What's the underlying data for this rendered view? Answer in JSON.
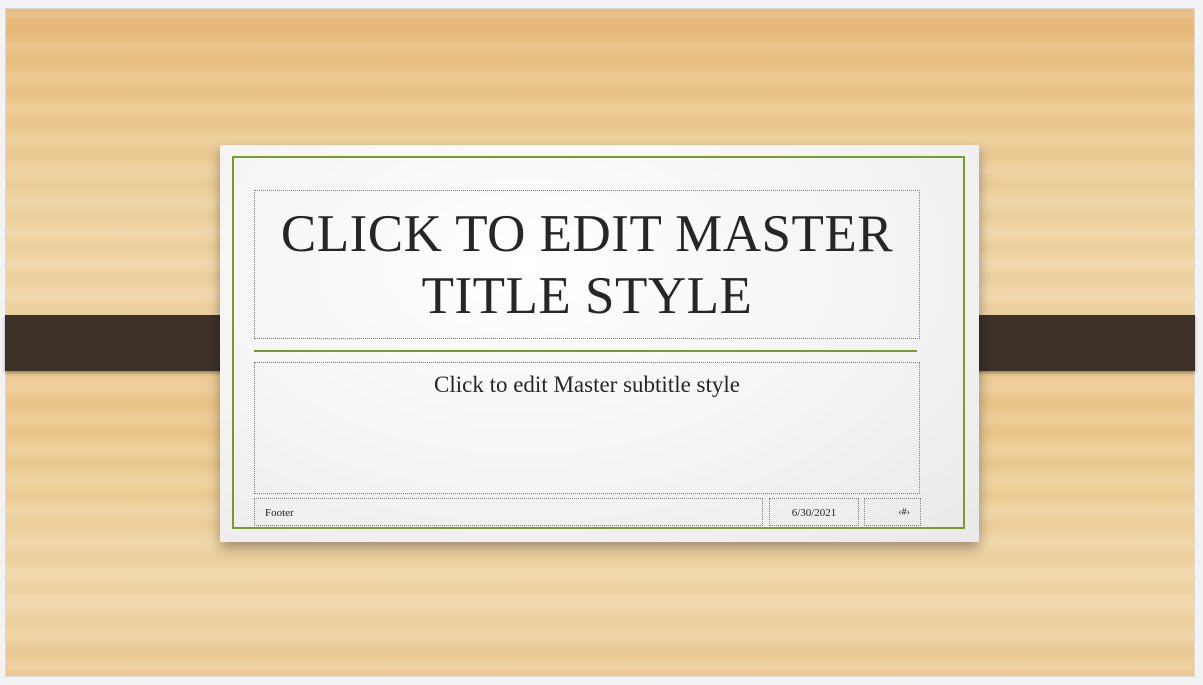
{
  "slide": {
    "title": "CLICK TO EDIT MASTER TITLE STYLE",
    "subtitle": "Click to edit Master subtitle style",
    "footer": "Footer",
    "date": "6/30/2021",
    "slide_number": "‹#›"
  },
  "colors": {
    "frame_accent": "#7a9a2b",
    "strap": "#3d3128",
    "text": "#262626"
  }
}
